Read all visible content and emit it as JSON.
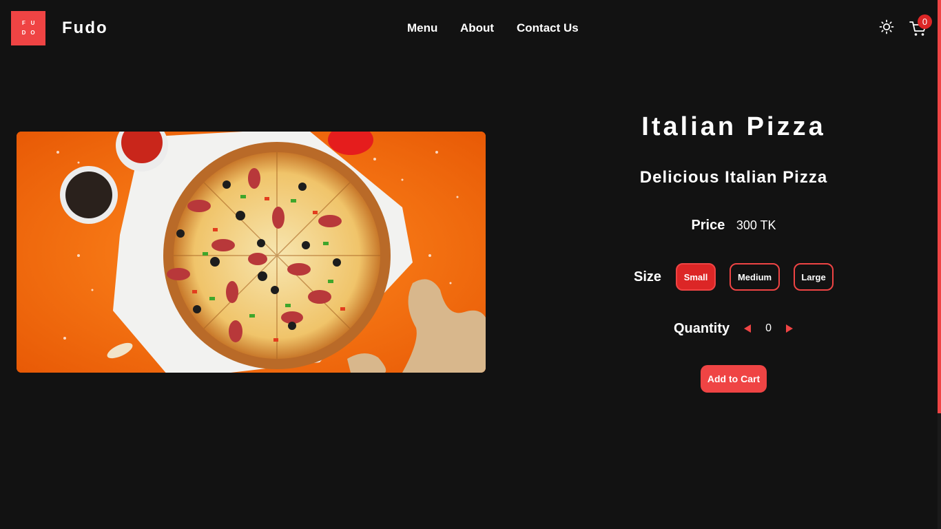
{
  "header": {
    "logo_letters": [
      "F",
      "U",
      "D",
      "O"
    ],
    "brand": "Fudo",
    "nav": [
      {
        "label": "Menu"
      },
      {
        "label": "About"
      },
      {
        "label": "Contact Us"
      }
    ],
    "cart_count": "0"
  },
  "product": {
    "title": "Italian Pizza",
    "subtitle": "Delicious Italian Pizza",
    "price_label": "Price",
    "price_value": "300 TK",
    "size_label": "Size",
    "sizes": [
      {
        "label": "Small",
        "selected": true
      },
      {
        "label": "Medium",
        "selected": false
      },
      {
        "label": "Large",
        "selected": false
      }
    ],
    "quantity_label": "Quantity",
    "quantity_value": "0",
    "add_to_cart": "Add to Cart"
  },
  "colors": {
    "background": "#121212",
    "accent": "#ef4444",
    "accent_dark": "#dc2626",
    "image_background": "#f26a10"
  },
  "icons": [
    "logo-icon",
    "sun-icon",
    "cart-icon",
    "chevron-left-icon",
    "chevron-right-icon"
  ]
}
